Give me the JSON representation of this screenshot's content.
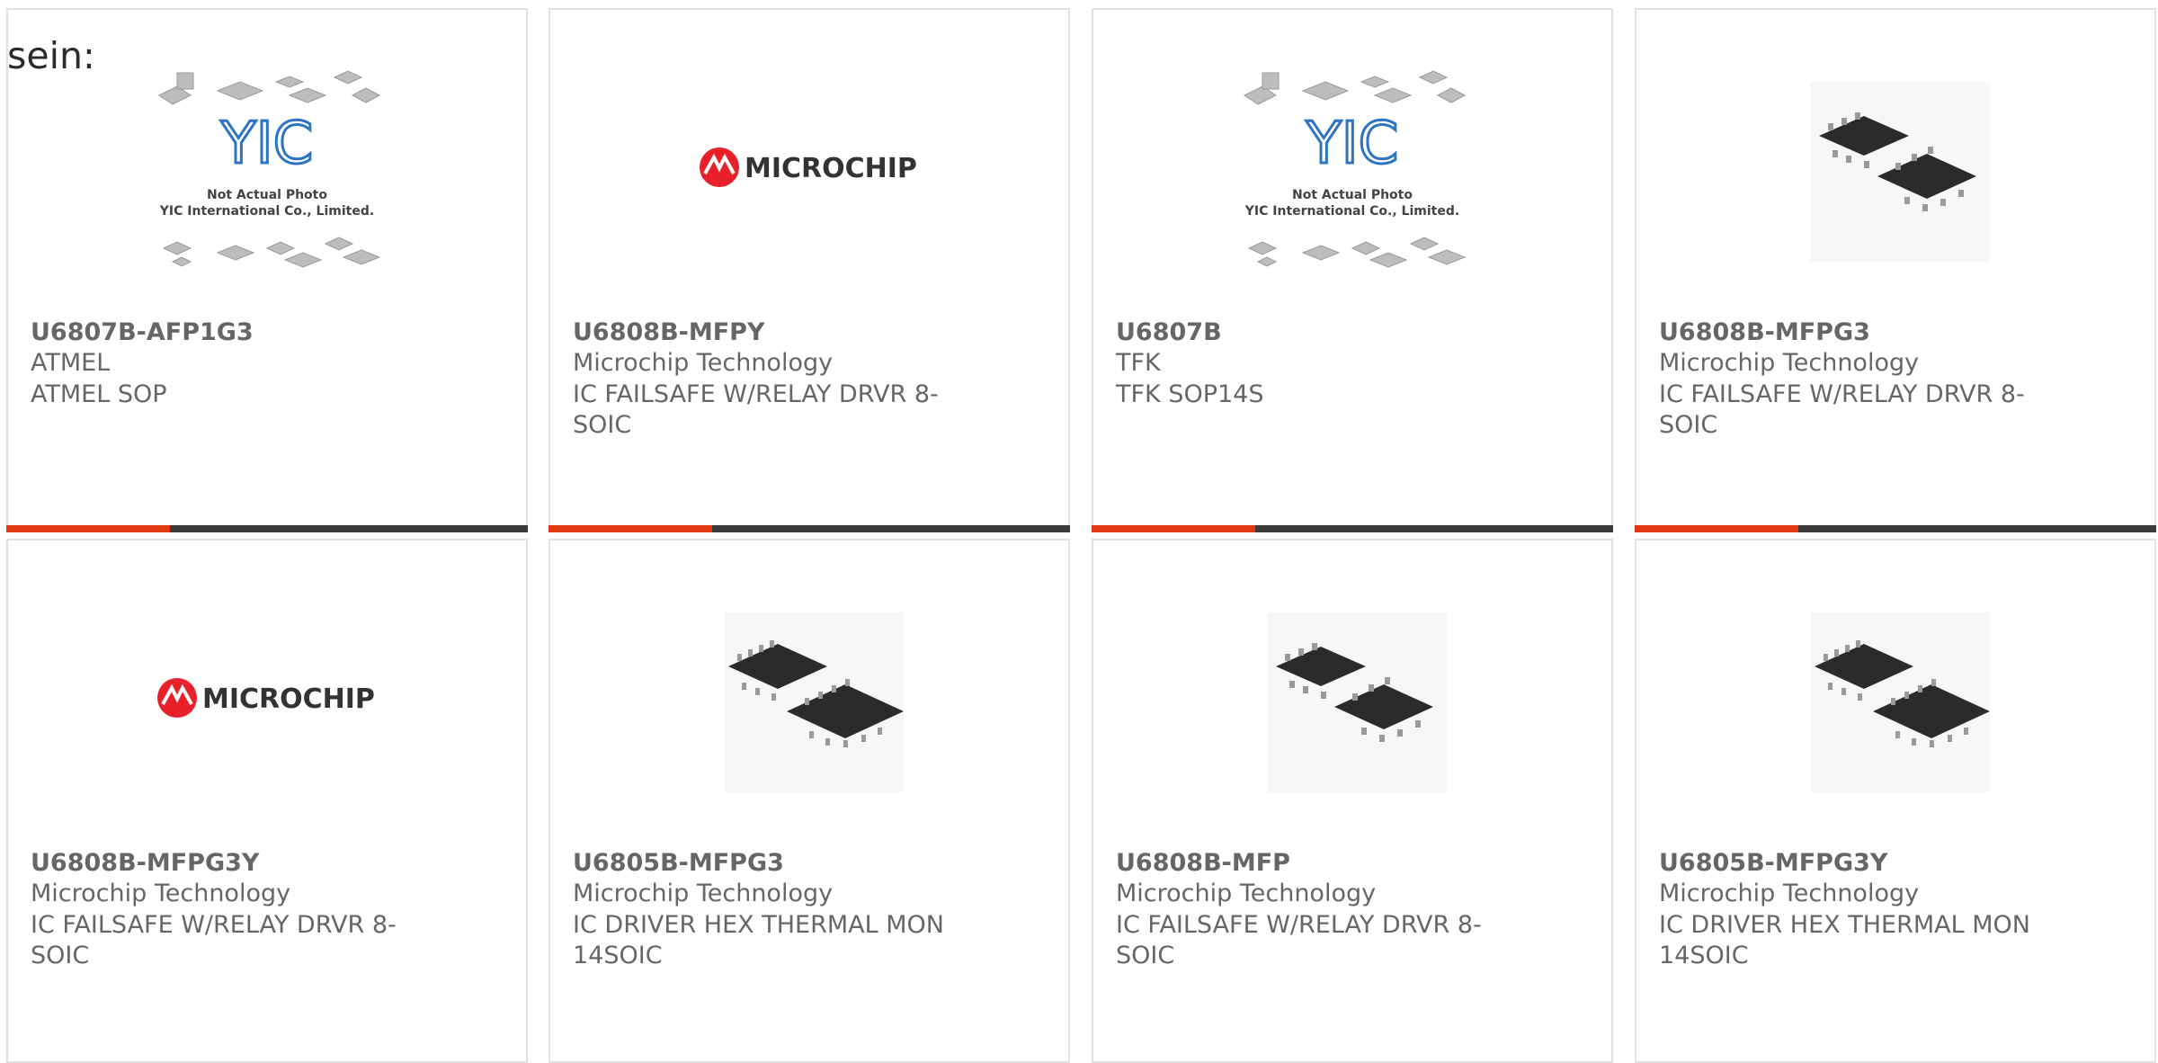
{
  "intro_text": "sein:",
  "logo": {
    "microchip_text": "MICROCHIP",
    "yic_line1": "Not Actual Photo",
    "yic_line2": "YIC International Co., Limited.",
    "yic_mark": "YIC"
  },
  "colors": {
    "accent": "#e03a12",
    "bar": "#3b3b3b",
    "text": "#666666",
    "microchip_red": "#e8202a",
    "yic_blue": "#2d74c5"
  },
  "products": [
    {
      "part": "U6807B-AFP1G3",
      "maker": "ATMEL",
      "desc": "ATMEL SOP",
      "image": "yic-placeholder-icon"
    },
    {
      "part": "U6808B-MFPY",
      "maker": "Microchip Technology",
      "desc": "IC FAILSAFE W/RELAY DRVR 8-SOIC",
      "image": "microchip-logo-icon"
    },
    {
      "part": "U6807B",
      "maker": "TFK",
      "desc": "TFK SOP14S",
      "image": "yic-placeholder-icon"
    },
    {
      "part": "U6808B-MFPG3",
      "maker": "Microchip Technology",
      "desc": "IC FAILSAFE W/RELAY DRVR 8-SOIC",
      "image": "soic8-chip-icon"
    },
    {
      "part": "U6808B-MFPG3Y",
      "maker": "Microchip Technology",
      "desc": "IC FAILSAFE W/RELAY DRVR 8-SOIC",
      "image": "microchip-logo-icon"
    },
    {
      "part": "U6805B-MFPG3",
      "maker": "Microchip Technology",
      "desc": "IC DRIVER HEX THERMAL MON 14SOIC",
      "image": "soic14-chip-icon"
    },
    {
      "part": "U6808B-MFP",
      "maker": "Microchip Technology",
      "desc": "IC FAILSAFE W/RELAY DRVR 8-SOIC",
      "image": "soic8-chip-icon"
    },
    {
      "part": "U6805B-MFPG3Y",
      "maker": "Microchip Technology",
      "desc": "IC DRIVER HEX THERMAL MON 14SOIC",
      "image": "soic14-chip-icon"
    }
  ]
}
